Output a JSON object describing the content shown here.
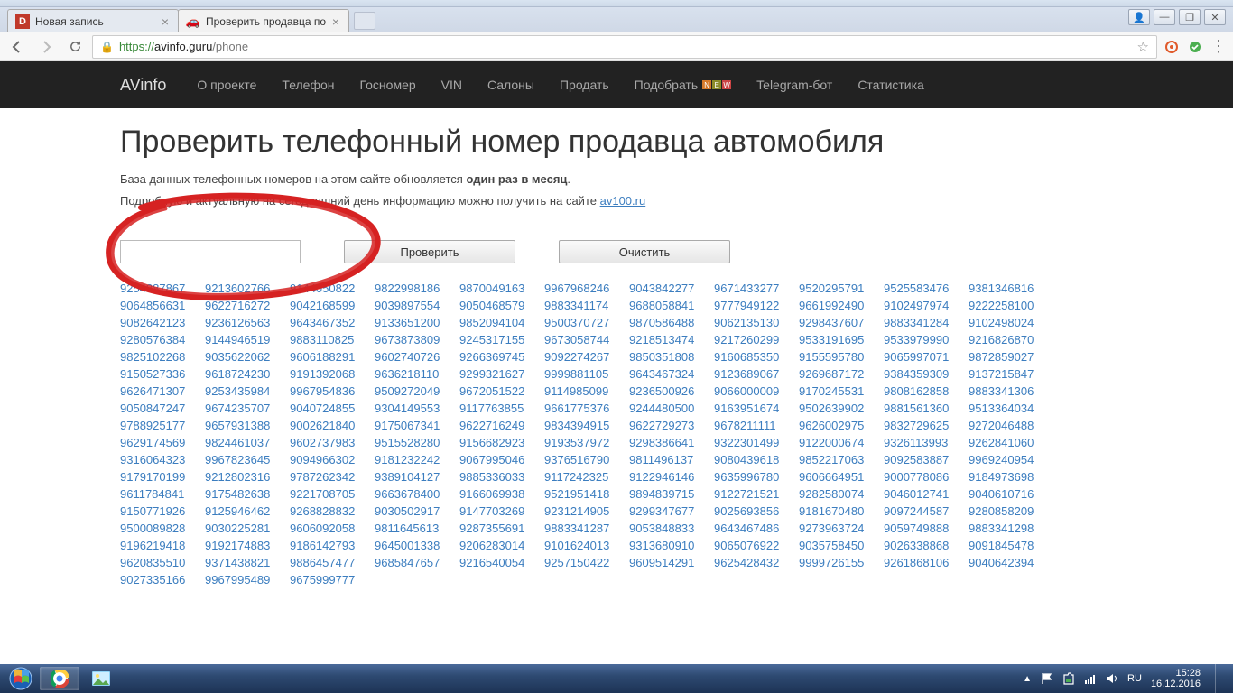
{
  "browser": {
    "tabs": [
      {
        "title": "Новая запись",
        "favicon": "D"
      },
      {
        "title": "Проверить продавца по",
        "favicon": "car"
      }
    ],
    "url_scheme": "https://",
    "url_host": "avinfo.guru",
    "url_path": "/phone"
  },
  "win_controls": {
    "user": "👤",
    "min": "—",
    "max": "❐",
    "close": "✕"
  },
  "nav": {
    "brand": "AVinfo",
    "items": [
      "О проекте",
      "Телефон",
      "Госномер",
      "VIN",
      "Салоны",
      "Продать",
      "Подобрать",
      "Telegram-бот",
      "Статистика"
    ],
    "badge": [
      "N",
      "E",
      "W"
    ]
  },
  "page": {
    "title": "Проверить телефонный номер продавца автомобиля",
    "desc1_a": "База данных телефонных номеров на этом сайте обновляется ",
    "desc1_b": "один раз в месяц",
    "desc1_c": ".",
    "desc2_a": "Подробную и актуальную на сегодняшний день информацию можно получить на сайте ",
    "desc2_link": "av100.ru",
    "btn_check": "Проверить",
    "btn_clear": "Очистить",
    "input_value": ""
  },
  "phones": [
    [
      "9254887867",
      "9213602766",
      "9144050822",
      "9822998186",
      "9870049163",
      "9967968246",
      "9043842277",
      "9671433277",
      "9520295791",
      "9525583476"
    ],
    [
      "9381346816",
      "9064856631",
      "9622716272",
      "9042168599",
      "9039897554",
      "9050468579",
      "9883341174",
      "9688058841",
      "9777949122",
      "9661992490"
    ],
    [
      "9102497974",
      "9222258100",
      "9082642123",
      "9236126563",
      "9643467352",
      "9133651200",
      "9852094104",
      "9500370727",
      "9870586488",
      "9062135130"
    ],
    [
      "9298437607",
      "9883341284",
      "9102498024",
      "9280576384",
      "9144946519",
      "9883110825",
      "9673873809",
      "9245317155",
      "9673058744",
      "9218513474"
    ],
    [
      "9217260299",
      "9533191695",
      "9533979990",
      "9216826870",
      "9825102268",
      "9035622062",
      "9606188291",
      "9602740726",
      "9266369745",
      "9092274267"
    ],
    [
      "9850351808",
      "9160685350",
      "9155595780",
      "9065997071",
      "9872859027",
      "9150527336",
      "9618724230",
      "9191392068",
      "9636218110",
      "9299321627"
    ],
    [
      "9999881105",
      "9643467324",
      "9123689067",
      "9269687172",
      "9384359309",
      "9137215847",
      "9626471307",
      "9253435984",
      "9967954836",
      "9509272049"
    ],
    [
      "9672051522",
      "9114985099",
      "9236500926",
      "9066000009",
      "9170245531",
      "9808162858",
      "9883341306",
      "9050847247",
      "9674235707",
      "9040724855"
    ],
    [
      "9304149553",
      "9117763855",
      "9661775376",
      "9244480500",
      "9163951674",
      "9502639902",
      "9881561360",
      "9513364034",
      "9788925177",
      "9657931388"
    ],
    [
      "9002621840",
      "9175067341",
      "9622716249",
      "9834394915",
      "9622729273",
      "9678211111",
      "9626002975",
      "9832729625",
      "9272046488",
      "9629174569"
    ],
    [
      "9824461037",
      "9602737983",
      "9515528280",
      "9156682923",
      "9193537972",
      "9298386641",
      "9322301499",
      "9122000674",
      "9326113993",
      "9262841060"
    ],
    [
      "9316064323",
      "9967823645",
      "9094966302",
      "9181232242",
      "9067995046",
      "9376516790",
      "9811496137",
      "9080439618",
      "9852217063",
      "9092583887"
    ],
    [
      "9969240954",
      "9179170199",
      "9212802316",
      "9787262342",
      "9389104127",
      "9885336033",
      "9117242325",
      "9122946146",
      "9635996780",
      "9606664951"
    ],
    [
      "9000778086",
      "9184973698",
      "9611784841",
      "9175482638",
      "9221708705",
      "9663678400",
      "9166069938",
      "9521951418",
      "9894839715",
      "9122721521"
    ],
    [
      "9282580074",
      "9046012741",
      "9040610716",
      "9150771926",
      "9125946462",
      "9268828832",
      "9030502917",
      "9147703269",
      "9231214905",
      "9299347677"
    ],
    [
      "9025693856",
      "9181670480",
      "9097244587",
      "9280858209",
      "9500089828",
      "9030225281",
      "9606092058",
      "9811645613",
      "9287355691",
      "9883341287"
    ],
    [
      "9053848833",
      "9643467486",
      "9273963724",
      "9059749888",
      "9883341298",
      "9196219418",
      "9192174883",
      "9186142793",
      "9645001338",
      "9206283014"
    ],
    [
      "9101624013",
      "9313680910",
      "9065076922",
      "9035758450",
      "9026338868",
      "9091845478",
      "9620835510",
      "9371438821",
      "9886457477",
      "9685847657"
    ],
    [
      "9216540054",
      "9257150422",
      "9609514291",
      "9625428432",
      "9999726155",
      "9261868106",
      "9040642394",
      "9027335166",
      "9967995489",
      "9675999777"
    ]
  ],
  "taskbar": {
    "lang": "RU",
    "time": "15:28",
    "date": "16.12.2016"
  }
}
